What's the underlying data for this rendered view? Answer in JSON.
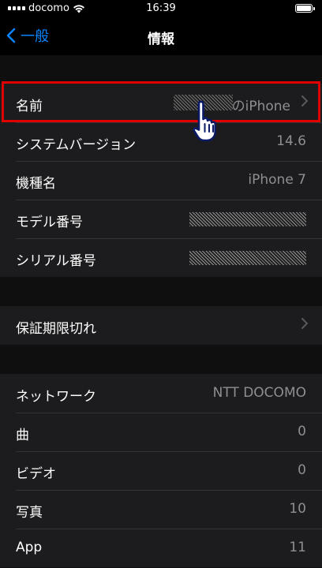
{
  "status_bar": {
    "carrier": "docomo",
    "time": "16:39"
  },
  "nav": {
    "back_label": "一般",
    "title": "情報"
  },
  "group1": [
    {
      "label": "名前",
      "value": "のiPhone",
      "chevron": true
    },
    {
      "label": "システムバージョン",
      "value": "14.6"
    },
    {
      "label": "機種名",
      "value": "iPhone 7"
    },
    {
      "label": "モデル番号",
      "value": ""
    },
    {
      "label": "シリアル番号",
      "value": ""
    }
  ],
  "group2": [
    {
      "label": "保証期限切れ",
      "chevron": true
    }
  ],
  "group3": [
    {
      "label": "ネットワーク",
      "value": "NTT DOCOMO"
    },
    {
      "label": "曲",
      "value": "0"
    },
    {
      "label": "ビデオ",
      "value": "0"
    },
    {
      "label": "写真",
      "value": "10"
    },
    {
      "label": "App",
      "value": "11"
    }
  ],
  "colors": {
    "accent": "#0a84ff",
    "highlight": "#e00000",
    "row_bg": "#1c1c1e",
    "secondary_text": "#8e8e93"
  }
}
